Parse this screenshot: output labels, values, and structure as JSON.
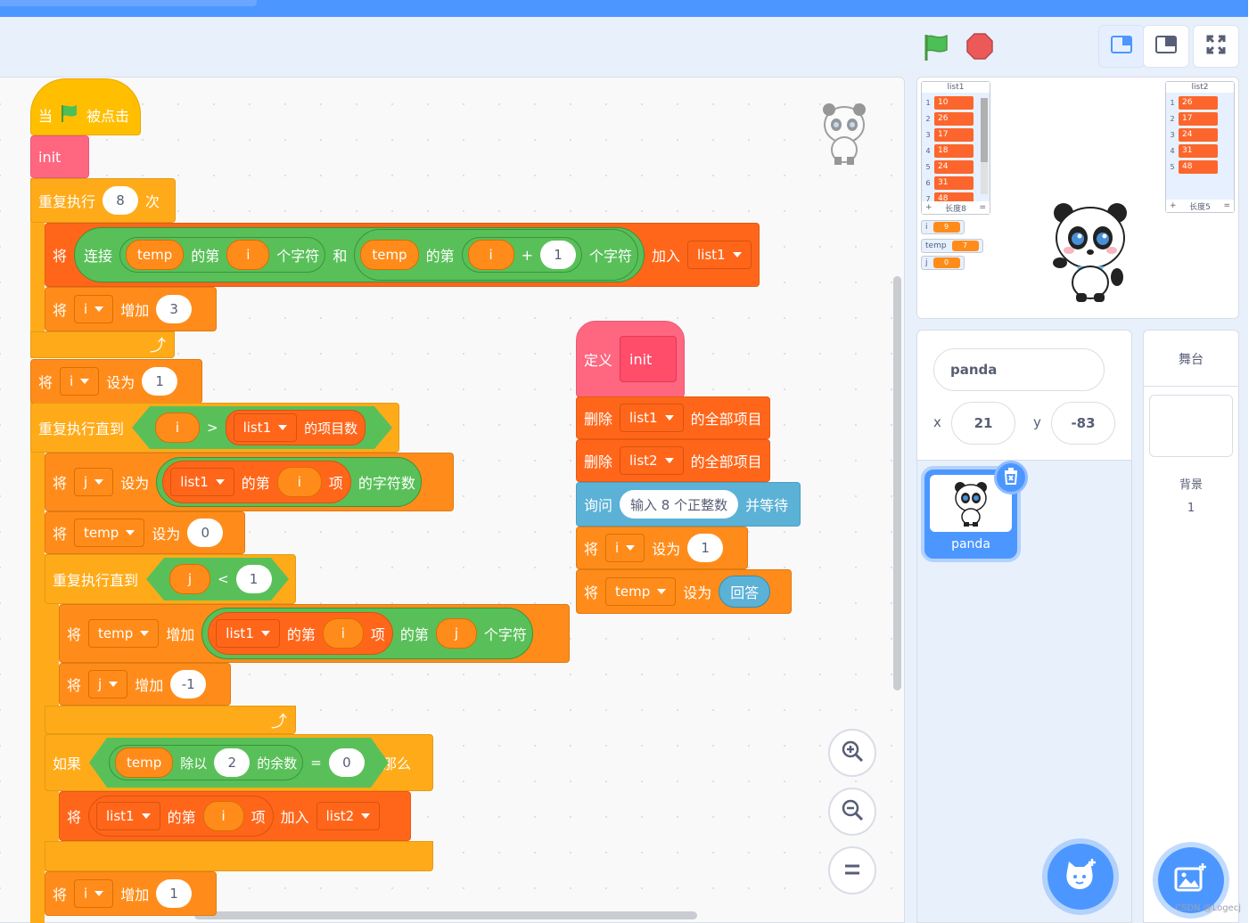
{
  "header": {
    "mode_buttons": [
      "small-stage",
      "normal-stage",
      "fullscreen"
    ]
  },
  "script_main": {
    "hat": {
      "when": "当",
      "clicked": "被点击"
    },
    "init_call": "init",
    "repeat1": {
      "label": "重复执行",
      "count": "8",
      "unit": "次"
    },
    "add_block": {
      "verb": "将",
      "join": "连接",
      "var_temp": "temp",
      "of_nth": "的第",
      "var_i": "i",
      "char": "个字符",
      "and": "和",
      "plus": "+",
      "one": "1",
      "add_to": "加入",
      "list": "list1"
    },
    "change_i": {
      "verb": "将",
      "var": "i",
      "change": "增加",
      "amount": "3"
    },
    "set_i": {
      "verb": "将",
      "var": "i",
      "set": "设为",
      "value": "1"
    },
    "until1": {
      "label": "重复执行直到",
      "var": "i",
      "op": ">",
      "list": "list1",
      "length": "的项目数"
    },
    "set_j": {
      "verb": "将",
      "var": "j",
      "set": "设为",
      "list": "list1",
      "of_nth": "的第",
      "idx": "i",
      "item": "项",
      "len": "的字符数"
    },
    "set_temp": {
      "verb": "将",
      "var": "temp",
      "set": "设为",
      "value": "0"
    },
    "until2": {
      "label": "重复执行直到",
      "var": "j",
      "op": "<",
      "value": "1"
    },
    "change_temp": {
      "verb": "将",
      "var": "temp",
      "change": "增加",
      "list": "list1",
      "of_nth": "的第",
      "idx": "i",
      "item": "项",
      "of_nth2": "的第",
      "j": "j",
      "char": "个字符"
    },
    "change_j": {
      "verb": "将",
      "var": "j",
      "change": "增加",
      "amount": "-1"
    },
    "if_block": {
      "if": "如果",
      "var": "temp",
      "mod": "除以",
      "two": "2",
      "rem": "的余数",
      "eq": "=",
      "zero": "0",
      "then": "那么"
    },
    "add_list2": {
      "verb": "将",
      "list": "list1",
      "of_nth": "的第",
      "idx": "i",
      "item": "项",
      "add_to": "加入",
      "list2": "list2"
    },
    "change_i2": {
      "verb": "将",
      "var": "i",
      "change": "增加",
      "amount": "1"
    }
  },
  "script_def": {
    "define": "定义",
    "name": "init",
    "del1": {
      "verb": "删除",
      "list": "list1",
      "all": "的全部项目"
    },
    "del2": {
      "verb": "删除",
      "list": "list2",
      "all": "的全部项目"
    },
    "ask": {
      "verb": "询问",
      "question": "输入 8 个正整数",
      "wait": "并等待"
    },
    "set_i": {
      "verb": "将",
      "var": "i",
      "set": "设为",
      "value": "1"
    },
    "set_temp": {
      "verb": "将",
      "var": "temp",
      "set": "设为",
      "answer": "回答"
    }
  },
  "stage": {
    "list1": {
      "title": "list1",
      "items": [
        "10",
        "26",
        "17",
        "18",
        "24",
        "31",
        "48"
      ],
      "indexes": [
        "1",
        "2",
        "3",
        "4",
        "5",
        "6",
        "7"
      ],
      "footer_plus": "+",
      "footer_len": "长度8",
      "footer_eq": "="
    },
    "list2": {
      "title": "list2",
      "items": [
        "26",
        "17",
        "24",
        "31",
        "48"
      ],
      "indexes": [
        "1",
        "2",
        "3",
        "4",
        "5"
      ],
      "footer_plus": "+",
      "footer_len": "长度5",
      "footer_eq": "="
    },
    "vars": [
      {
        "name": "i",
        "value": "9"
      },
      {
        "name": "temp",
        "value": "7"
      },
      {
        "name": "j",
        "value": "0"
      }
    ]
  },
  "sprite_info": {
    "name": "panda",
    "x_label": "x",
    "x": "21",
    "y_label": "y",
    "y": "-83",
    "sprites": [
      {
        "name": "panda"
      }
    ]
  },
  "stage_panel": {
    "title": "舞台",
    "backdrop_label": "背景",
    "backdrop_count": "1"
  },
  "watermark": "CSDN @Logecj",
  "colors": {
    "motion_blue": "#4c97ff",
    "events": "#ffbf00",
    "control": "#ffab19",
    "variables": "#ff8c1a",
    "lists": "#ff661a",
    "myblocks": "#ff6680",
    "operators": "#59c059",
    "sensing": "#5cb1d6"
  }
}
